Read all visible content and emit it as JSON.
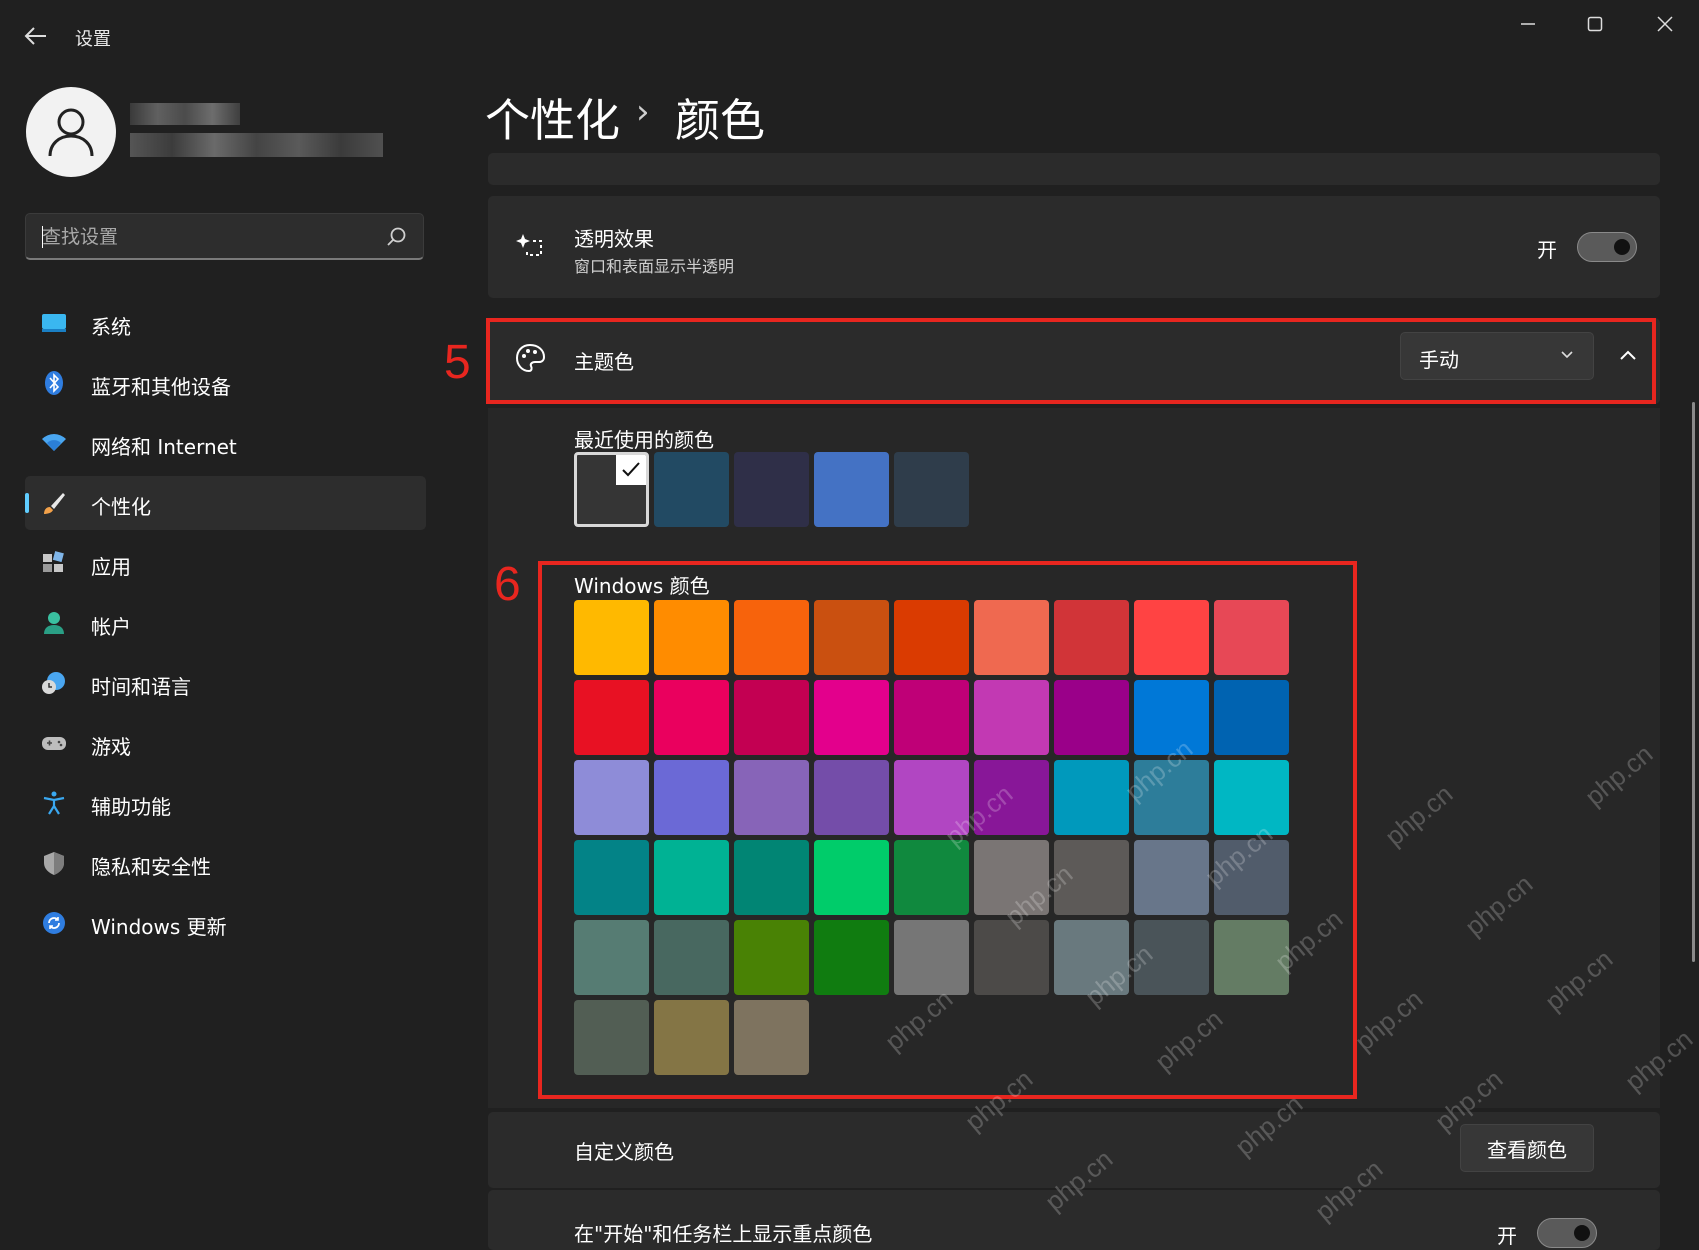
{
  "app": {
    "title": "设置"
  },
  "search": {
    "placeholder": "查找设置"
  },
  "nav": {
    "items": [
      {
        "label": "系统",
        "icon": "system-icon"
      },
      {
        "label": "蓝牙和其他设备",
        "icon": "bluetooth-icon"
      },
      {
        "label": "网络和 Internet",
        "icon": "wifi-icon"
      },
      {
        "label": "个性化",
        "icon": "brush-icon",
        "active": true
      },
      {
        "label": "应用",
        "icon": "apps-icon"
      },
      {
        "label": "帐户",
        "icon": "account-icon"
      },
      {
        "label": "时间和语言",
        "icon": "time-language-icon"
      },
      {
        "label": "游戏",
        "icon": "gamepad-icon"
      },
      {
        "label": "辅助功能",
        "icon": "accessibility-icon"
      },
      {
        "label": "隐私和安全性",
        "icon": "shield-icon"
      },
      {
        "label": "Windows 更新",
        "icon": "update-icon"
      }
    ]
  },
  "header": {
    "breadcrumb_parent": "个性化",
    "separator": "›",
    "breadcrumb_current": "颜色"
  },
  "transparency": {
    "title": "透明效果",
    "subtitle": "窗口和表面显示半透明",
    "state_label": "开",
    "on": true
  },
  "accent": {
    "title": "主题色",
    "mode_value": "手动",
    "recent_label": "最近使用的颜色",
    "recent_colors": [
      "#353535",
      "#224a63",
      "#2f2f48",
      "#4472c4",
      "#2f3d4b"
    ],
    "windows_label": "Windows 颜色",
    "windows_colors": [
      "#ffb900",
      "#ff8c00",
      "#f7630c",
      "#ca5010",
      "#da3b01",
      "#ef6950",
      "#d13438",
      "#ff4343",
      "#e74856",
      "#e81123",
      "#ea005e",
      "#c30052",
      "#e3008c",
      "#bf0077",
      "#c239b3",
      "#9a0089",
      "#0078d7",
      "#0063b1",
      "#8e8cd8",
      "#6b69d6",
      "#8764b8",
      "#744da9",
      "#b146c2",
      "#881798",
      "#0099bc",
      "#2d7d9a",
      "#00b7c3",
      "#038387",
      "#00b294",
      "#018574",
      "#00cc6a",
      "#10893e",
      "#7a7574",
      "#5d5a58",
      "#68768a",
      "#515c6b",
      "#567c73",
      "#486860",
      "#498205",
      "#107c10",
      "#767676",
      "#4c4a48",
      "#69797e",
      "#4a5459",
      "#647c64",
      "#525e54",
      "#847545",
      "#7e735f"
    ]
  },
  "custom": {
    "title": "自定义颜色",
    "button_label": "查看颜色"
  },
  "start_taskbar": {
    "title": "在\"开始\"和任务栏上显示重点颜色",
    "state_label": "开"
  },
  "annotations": {
    "label_5": "5",
    "label_6": "6",
    "color": "#e8261f"
  },
  "watermark": {
    "text": "php.cn"
  },
  "colors": {
    "background": "#202020",
    "card": "#2b2b2b",
    "accent_indicator": "#60cdff"
  }
}
